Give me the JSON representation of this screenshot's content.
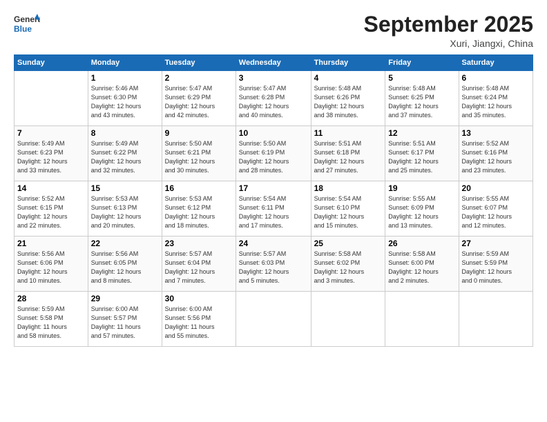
{
  "logo": {
    "line1": "General",
    "line2": "Blue"
  },
  "title": "September 2025",
  "location": "Xuri, Jiangxi, China",
  "headers": [
    "Sunday",
    "Monday",
    "Tuesday",
    "Wednesday",
    "Thursday",
    "Friday",
    "Saturday"
  ],
  "weeks": [
    [
      {
        "day": "",
        "info": ""
      },
      {
        "day": "1",
        "info": "Sunrise: 5:46 AM\nSunset: 6:30 PM\nDaylight: 12 hours\nand 43 minutes."
      },
      {
        "day": "2",
        "info": "Sunrise: 5:47 AM\nSunset: 6:29 PM\nDaylight: 12 hours\nand 42 minutes."
      },
      {
        "day": "3",
        "info": "Sunrise: 5:47 AM\nSunset: 6:28 PM\nDaylight: 12 hours\nand 40 minutes."
      },
      {
        "day": "4",
        "info": "Sunrise: 5:48 AM\nSunset: 6:26 PM\nDaylight: 12 hours\nand 38 minutes."
      },
      {
        "day": "5",
        "info": "Sunrise: 5:48 AM\nSunset: 6:25 PM\nDaylight: 12 hours\nand 37 minutes."
      },
      {
        "day": "6",
        "info": "Sunrise: 5:48 AM\nSunset: 6:24 PM\nDaylight: 12 hours\nand 35 minutes."
      }
    ],
    [
      {
        "day": "7",
        "info": "Sunrise: 5:49 AM\nSunset: 6:23 PM\nDaylight: 12 hours\nand 33 minutes."
      },
      {
        "day": "8",
        "info": "Sunrise: 5:49 AM\nSunset: 6:22 PM\nDaylight: 12 hours\nand 32 minutes."
      },
      {
        "day": "9",
        "info": "Sunrise: 5:50 AM\nSunset: 6:21 PM\nDaylight: 12 hours\nand 30 minutes."
      },
      {
        "day": "10",
        "info": "Sunrise: 5:50 AM\nSunset: 6:19 PM\nDaylight: 12 hours\nand 28 minutes."
      },
      {
        "day": "11",
        "info": "Sunrise: 5:51 AM\nSunset: 6:18 PM\nDaylight: 12 hours\nand 27 minutes."
      },
      {
        "day": "12",
        "info": "Sunrise: 5:51 AM\nSunset: 6:17 PM\nDaylight: 12 hours\nand 25 minutes."
      },
      {
        "day": "13",
        "info": "Sunrise: 5:52 AM\nSunset: 6:16 PM\nDaylight: 12 hours\nand 23 minutes."
      }
    ],
    [
      {
        "day": "14",
        "info": "Sunrise: 5:52 AM\nSunset: 6:15 PM\nDaylight: 12 hours\nand 22 minutes."
      },
      {
        "day": "15",
        "info": "Sunrise: 5:53 AM\nSunset: 6:13 PM\nDaylight: 12 hours\nand 20 minutes."
      },
      {
        "day": "16",
        "info": "Sunrise: 5:53 AM\nSunset: 6:12 PM\nDaylight: 12 hours\nand 18 minutes."
      },
      {
        "day": "17",
        "info": "Sunrise: 5:54 AM\nSunset: 6:11 PM\nDaylight: 12 hours\nand 17 minutes."
      },
      {
        "day": "18",
        "info": "Sunrise: 5:54 AM\nSunset: 6:10 PM\nDaylight: 12 hours\nand 15 minutes."
      },
      {
        "day": "19",
        "info": "Sunrise: 5:55 AM\nSunset: 6:09 PM\nDaylight: 12 hours\nand 13 minutes."
      },
      {
        "day": "20",
        "info": "Sunrise: 5:55 AM\nSunset: 6:07 PM\nDaylight: 12 hours\nand 12 minutes."
      }
    ],
    [
      {
        "day": "21",
        "info": "Sunrise: 5:56 AM\nSunset: 6:06 PM\nDaylight: 12 hours\nand 10 minutes."
      },
      {
        "day": "22",
        "info": "Sunrise: 5:56 AM\nSunset: 6:05 PM\nDaylight: 12 hours\nand 8 minutes."
      },
      {
        "day": "23",
        "info": "Sunrise: 5:57 AM\nSunset: 6:04 PM\nDaylight: 12 hours\nand 7 minutes."
      },
      {
        "day": "24",
        "info": "Sunrise: 5:57 AM\nSunset: 6:03 PM\nDaylight: 12 hours\nand 5 minutes."
      },
      {
        "day": "25",
        "info": "Sunrise: 5:58 AM\nSunset: 6:02 PM\nDaylight: 12 hours\nand 3 minutes."
      },
      {
        "day": "26",
        "info": "Sunrise: 5:58 AM\nSunset: 6:00 PM\nDaylight: 12 hours\nand 2 minutes."
      },
      {
        "day": "27",
        "info": "Sunrise: 5:59 AM\nSunset: 5:59 PM\nDaylight: 12 hours\nand 0 minutes."
      }
    ],
    [
      {
        "day": "28",
        "info": "Sunrise: 5:59 AM\nSunset: 5:58 PM\nDaylight: 11 hours\nand 58 minutes."
      },
      {
        "day": "29",
        "info": "Sunrise: 6:00 AM\nSunset: 5:57 PM\nDaylight: 11 hours\nand 57 minutes."
      },
      {
        "day": "30",
        "info": "Sunrise: 6:00 AM\nSunset: 5:56 PM\nDaylight: 11 hours\nand 55 minutes."
      },
      {
        "day": "",
        "info": ""
      },
      {
        "day": "",
        "info": ""
      },
      {
        "day": "",
        "info": ""
      },
      {
        "day": "",
        "info": ""
      }
    ]
  ]
}
